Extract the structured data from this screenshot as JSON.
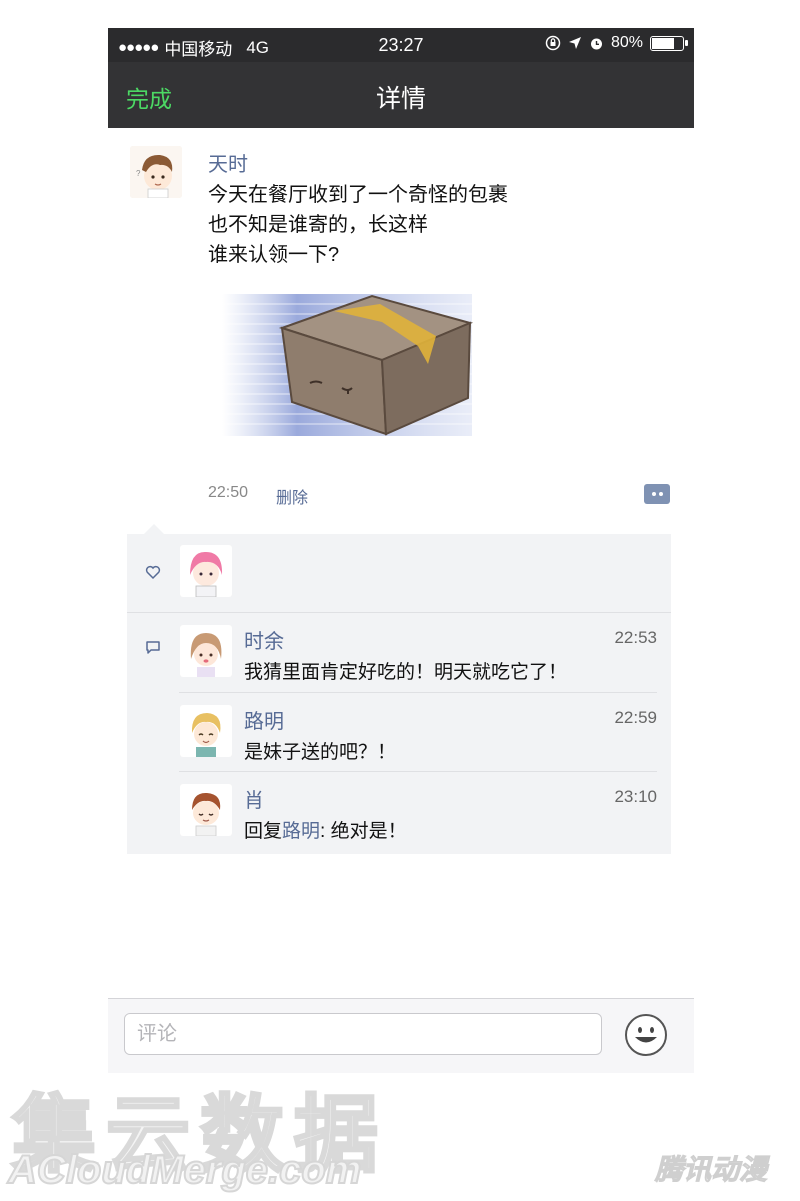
{
  "status_bar": {
    "signal_dots": "●●●●●",
    "carrier": "中国移动",
    "network": "4G",
    "time": "23:27",
    "battery": "80%",
    "battery_level": 0.8,
    "icons": [
      "orientation-lock-icon",
      "location-arrow-icon",
      "alarm-icon",
      "battery-icon"
    ]
  },
  "nav": {
    "done_label": "完成",
    "title": "详情",
    "done_color": "#4cd964"
  },
  "post": {
    "author": "天时",
    "lines": [
      "今天在餐厅收到了一个奇怪的包裹",
      "也不知是谁寄的，长这样",
      "谁来认领一下?"
    ],
    "image": "cardboard-box-illustration",
    "time": "22:50",
    "delete_label": "删除",
    "more_icon": "comment-more-icon"
  },
  "likes": {
    "icon": "heart-icon",
    "avatars": [
      "avatar-pink-hair"
    ]
  },
  "comments": [
    {
      "name": "时余",
      "time": "22:53",
      "text": "我猜里面肯定好吃的！明天就吃它了！"
    },
    {
      "name": "路明",
      "time": "22:59",
      "text": "是妹子送的吧？！"
    },
    {
      "name": "肖",
      "time": "23:10",
      "reply_prefix": "回复",
      "reply_to": "路明",
      "text": ": 绝对是！"
    }
  ],
  "input_bar": {
    "placeholder": "评论",
    "emoji_icon": "emoji-smile-icon"
  },
  "watermark": {
    "cn": "集云数据",
    "en": "ACloudMerge.com",
    "tencent": "腾讯动漫"
  },
  "colors": {
    "link_blue": "#576b95",
    "header_bg": "#333335",
    "panel_bg": "#f2f3f5"
  }
}
